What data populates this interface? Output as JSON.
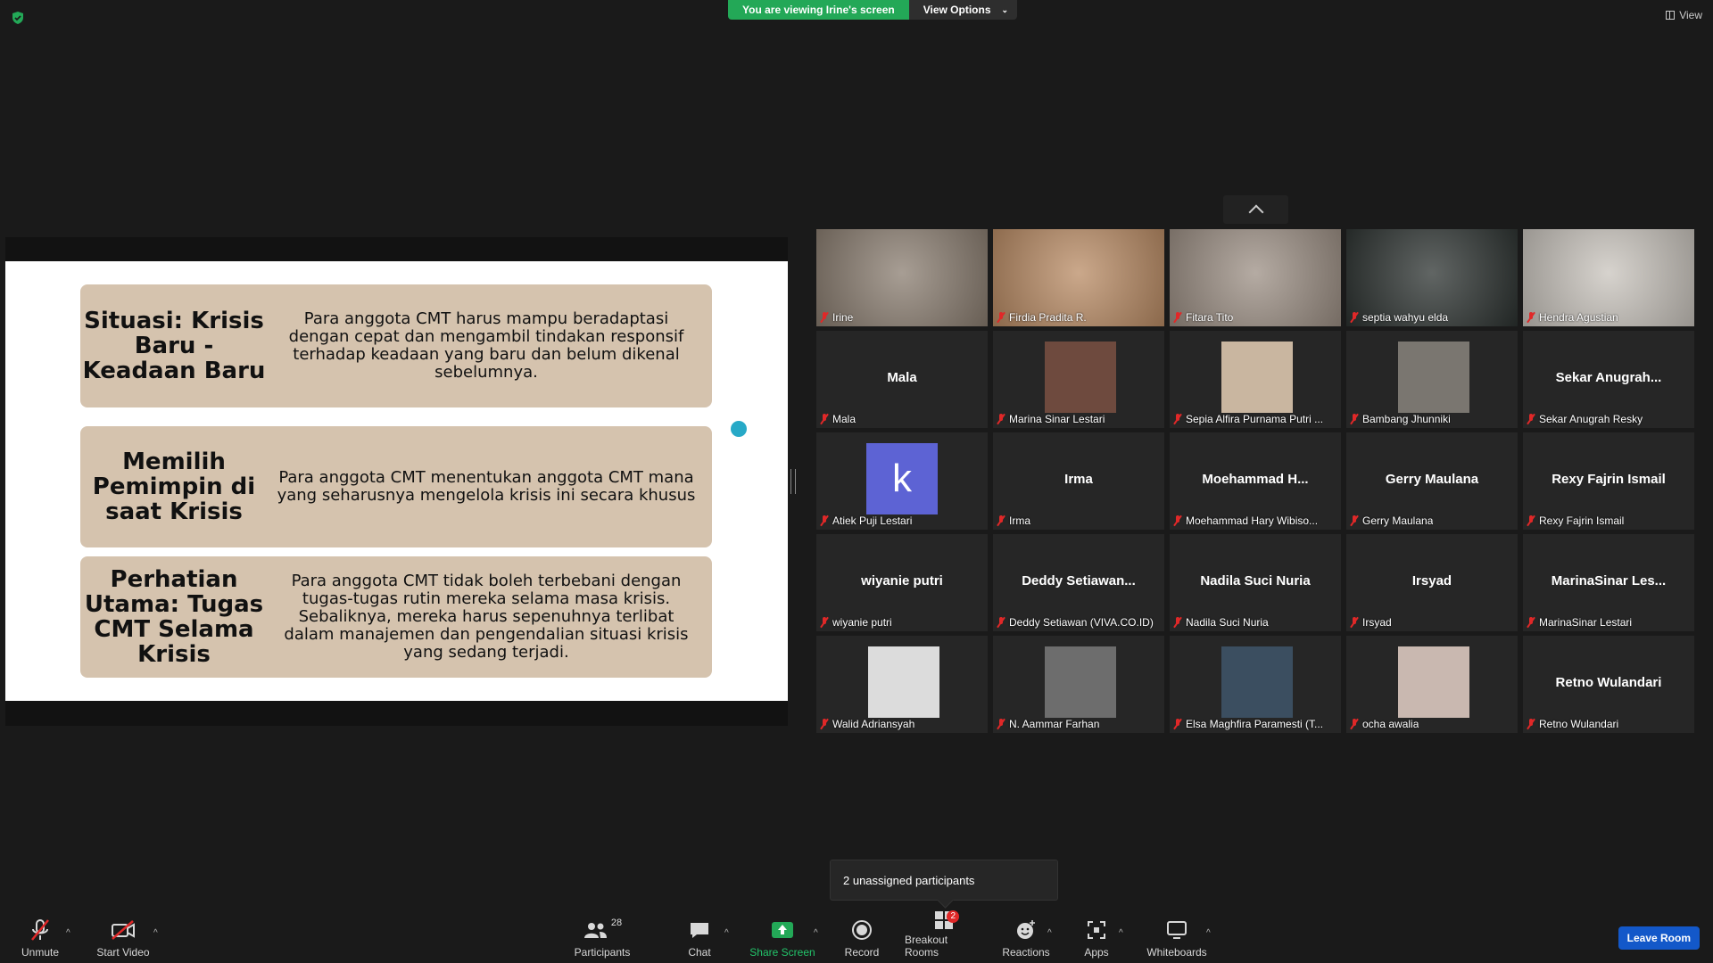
{
  "top_bar": {
    "viewing_text": "You are viewing Irine's screen",
    "view_options_label": "View Options",
    "view_label": "View"
  },
  "slide": {
    "rows": [
      {
        "heading": "Situasi: Krisis Baru - Keadaan Baru",
        "text": "Para anggota CMT  harus mampu beradaptasi dengan cepat dan mengambil tindakan responsif terhadap keadaan yang baru dan belum dikenal sebelumnya."
      },
      {
        "heading": "Memilih Pemimpin di saat Krisis",
        "text": "Para anggota CMT menentukan anggota CMT mana yang seharusnya mengelola krisis ini secara khusus"
      },
      {
        "heading": "Perhatian Utama: Tugas CMT Selama Krisis",
        "text": "Para anggota CMT tidak boleh terbebani dengan tugas-tugas rutin mereka selama masa krisis. Sebaliknya, mereka harus sepenuhnya terlibat dalam manajemen dan pengendalian situasi krisis yang sedang terjadi."
      }
    ]
  },
  "gallery": {
    "tiles": [
      {
        "center": "",
        "label": "Irine"
      },
      {
        "center": "",
        "label": "Firdia Pradita R."
      },
      {
        "center": "",
        "label": "Fitara Tito"
      },
      {
        "center": "",
        "label": "septia wahyu elda"
      },
      {
        "center": "",
        "label": "Hendra Agustian"
      },
      {
        "center": "Mala",
        "label": "Mala"
      },
      {
        "center": "",
        "label": "Marina Sinar Lestari"
      },
      {
        "center": "",
        "label": "Sepia Alfira Purnama Putri ..."
      },
      {
        "center": "",
        "label": "Bambang Jhunniki"
      },
      {
        "center": "Sekar  Anugrah...",
        "label": "Sekar Anugrah Resky"
      },
      {
        "center": "",
        "label": "Atiek Puji Lestari",
        "avatar_letter": "k"
      },
      {
        "center": "Irma",
        "label": "Irma"
      },
      {
        "center": "Moehammad  H...",
        "label": "Moehammad Hary Wibiso..."
      },
      {
        "center": "Gerry Maulana",
        "label": "Gerry Maulana"
      },
      {
        "center": "Rexy Fajrin Ismail",
        "label": "Rexy Fajrin Ismail"
      },
      {
        "center": "wiyanie putri",
        "label": "wiyanie putri"
      },
      {
        "center": "Deddy  Setiawan...",
        "label": "Deddy Setiawan (VIVA.CO.ID)"
      },
      {
        "center": "Nadila Suci Nuria",
        "label": "Nadila Suci Nuria"
      },
      {
        "center": "Irsyad",
        "label": "Irsyad"
      },
      {
        "center": "MarinaSinar  Les...",
        "label": "MarinaSinar Lestari"
      },
      {
        "center": "",
        "label": "Walid Adriansyah"
      },
      {
        "center": "",
        "label": "N. Aammar Farhan"
      },
      {
        "center": "",
        "label": "Elsa Maghfira Paramesti (T..."
      },
      {
        "center": "",
        "label": "ocha awalia"
      },
      {
        "center": "Retno Wulandari",
        "label": "Retno Wulandari"
      }
    ]
  },
  "popover": {
    "text": "2 unassigned participants"
  },
  "toolbar": {
    "unmute": "Unmute",
    "start_video": "Start Video",
    "participants": "Participants",
    "participants_count": "28",
    "chat": "Chat",
    "share_screen": "Share Screen",
    "record": "Record",
    "breakout_rooms": "Breakout Rooms",
    "breakout_badge": "2",
    "reactions": "Reactions",
    "apps": "Apps",
    "whiteboards": "Whiteboards",
    "leave_room": "Leave Room",
    "colors": {
      "accent_green": "#23a857",
      "leave_blue": "#1358c9",
      "mute_red": "#e02828"
    }
  }
}
